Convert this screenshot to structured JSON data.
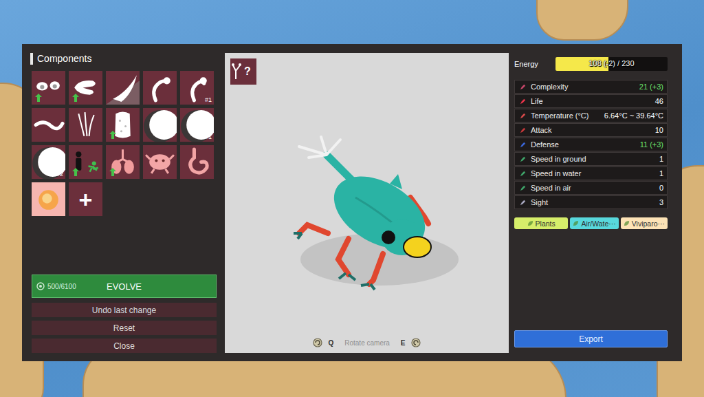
{
  "components": {
    "title": "Components",
    "tiles": [
      {
        "kind": "part",
        "upgrade": true,
        "badge": ""
      },
      {
        "kind": "part",
        "upgrade": true,
        "badge": ""
      },
      {
        "kind": "part",
        "upgrade": false,
        "badge": ""
      },
      {
        "kind": "part",
        "upgrade": false,
        "badge": ""
      },
      {
        "kind": "part",
        "upgrade": false,
        "badge": "#1"
      },
      {
        "kind": "part",
        "upgrade": false,
        "badge": ""
      },
      {
        "kind": "part",
        "upgrade": false,
        "badge": ""
      },
      {
        "kind": "part",
        "upgrade": true,
        "badge": ""
      },
      {
        "kind": "part",
        "upgrade": false,
        "badge": ""
      },
      {
        "kind": "part",
        "upgrade": false,
        "badge": "#1"
      },
      {
        "kind": "part",
        "upgrade": false,
        "badge": "#2"
      },
      {
        "kind": "part",
        "upgrade": true,
        "badge": ""
      },
      {
        "kind": "part",
        "upgrade": true,
        "badge": ""
      },
      {
        "kind": "part",
        "upgrade": false,
        "badge": ""
      },
      {
        "kind": "part",
        "upgrade": false,
        "badge": ""
      },
      {
        "kind": "part",
        "upgrade": false,
        "badge": ""
      },
      {
        "kind": "add",
        "label": "+"
      }
    ]
  },
  "evolve": {
    "cost": "500/6100",
    "label": "EVOLVE"
  },
  "actions": [
    "Undo last change",
    "Reset",
    "Close"
  ],
  "preview": {
    "help_glyph": "?",
    "controls": {
      "left_key": "Q",
      "label": "Rotate camera",
      "right_key": "E"
    }
  },
  "energy": {
    "label": "Energy",
    "value": "108 (-2) / 230",
    "level": 0.47
  },
  "stats": [
    {
      "label": "Complexity",
      "value": "21 (+3)",
      "improved": true,
      "color": "#c8466a"
    },
    {
      "label": "Life",
      "value": "46",
      "improved": false,
      "color": "#e8334a"
    },
    {
      "label": "Temperature (°C)",
      "value": "6.64°C ~ 39.64°C",
      "improved": false,
      "color": "#d84a4a"
    },
    {
      "label": "Attack",
      "value": "10",
      "improved": false,
      "color": "#c8383a"
    },
    {
      "label": "Defense",
      "value": "11 (+3)",
      "improved": true,
      "color": "#3a66d8"
    },
    {
      "label": "Speed in ground",
      "value": "1",
      "improved": false,
      "color": "#3fa56a"
    },
    {
      "label": "Speed in water",
      "value": "1",
      "improved": false,
      "color": "#3fa56a"
    },
    {
      "label": "Speed in air",
      "value": "0",
      "improved": false,
      "color": "#3fa56a"
    },
    {
      "label": "Sight",
      "value": "3",
      "improved": false,
      "color": "#a8a8c0"
    }
  ],
  "tags": [
    {
      "label": "Plants",
      "color": "#d6ee6a"
    },
    {
      "label": "Air/Wate···",
      "color": "#58d8dc"
    },
    {
      "label": "Viviparo···",
      "color": "#fde3b6"
    }
  ],
  "export": "Export"
}
